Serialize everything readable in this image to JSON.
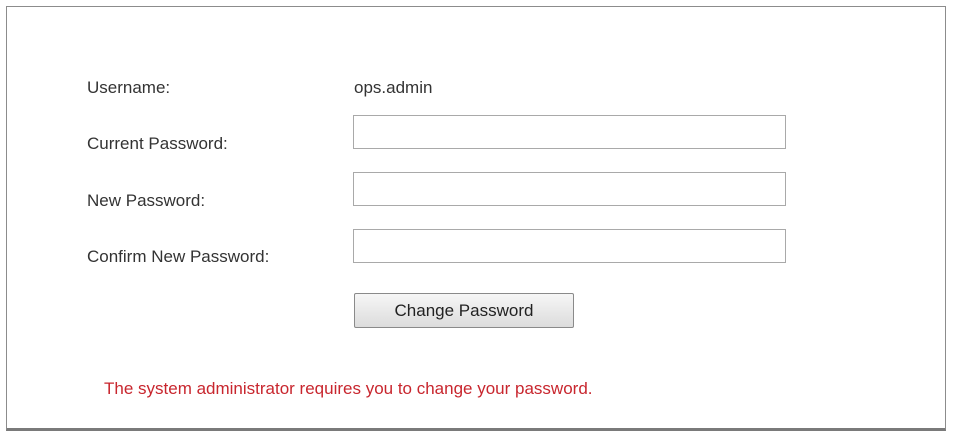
{
  "form": {
    "username_label": "Username:",
    "username_value": "ops.admin",
    "current_password_label": "Current Password:",
    "current_password_value": "",
    "new_password_label": "New Password:",
    "new_password_value": "",
    "confirm_password_label": "Confirm New Password:",
    "confirm_password_value": "",
    "submit_label": "Change Password"
  },
  "notice": {
    "text": "The system administrator requires you to change your password.",
    "color": "#c8262e"
  }
}
